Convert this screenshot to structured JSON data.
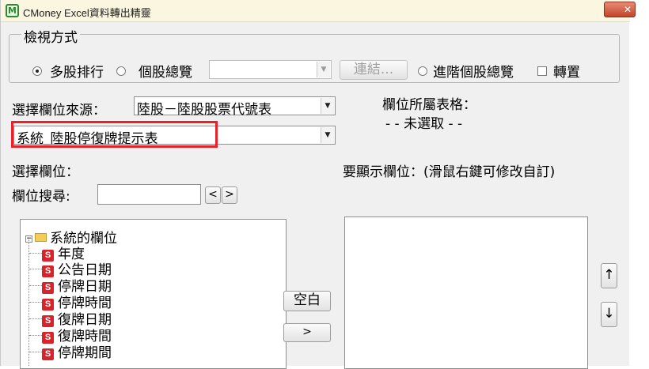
{
  "window": {
    "title": "CMoney Excel資料轉出精靈",
    "app_icon_glyph": "M"
  },
  "view_mode": {
    "legend": "檢視方式",
    "options": [
      {
        "label": "多股排行",
        "selected": true
      },
      {
        "label": "個股總覽",
        "selected": false
      },
      {
        "label": "進階個股總覽",
        "selected": false
      }
    ],
    "stock_select_value": "",
    "link_button": "連結...",
    "transpose_label": "轉置",
    "transpose_checked": false
  },
  "source": {
    "label": "選擇欄位來源：",
    "value": "陸股－陸股股票代號表",
    "table_value": "系統_陸股停復牌提示表"
  },
  "belong_table": {
    "label": "欄位所屬表格：",
    "value": "- - 未選取 - -"
  },
  "select_fields": {
    "label": "選擇欄位："
  },
  "field_search": {
    "label": "欄位搜尋:",
    "value": "",
    "prev_button": "<",
    "next_button": ">"
  },
  "display_fields": {
    "label": "要顯示欄位：(滑鼠右鍵可修改自訂)"
  },
  "tree": {
    "root_label": "系統的欄位",
    "item_badge": "S",
    "items": [
      "年度",
      "公告日期",
      "停牌日期",
      "停牌時間",
      "復牌日期",
      "復牌時間",
      "停牌期間"
    ]
  },
  "buttons": {
    "blank": "空白",
    "add": ">",
    "move_up": "↑",
    "move_down": "↓"
  },
  "colors": {
    "highlight_border": "#e8212b",
    "badge_red": "#d8232a",
    "link_disabled": "#a0a0a0"
  }
}
